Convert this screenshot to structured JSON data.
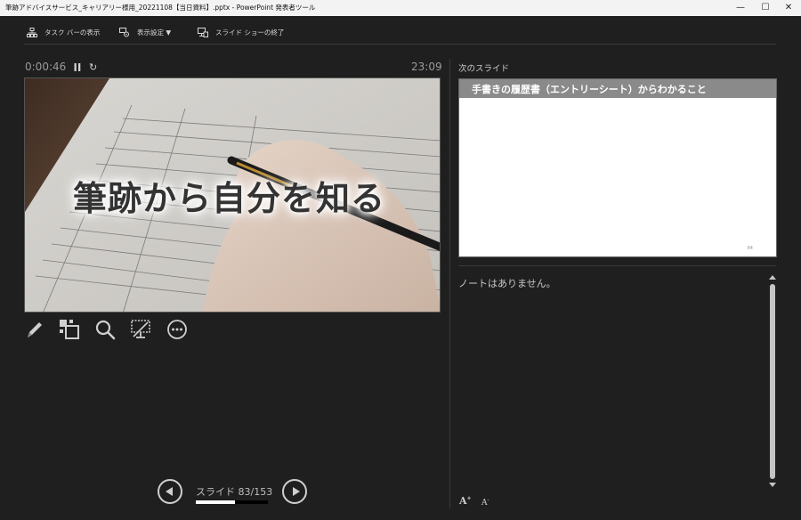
{
  "window": {
    "title": "筆跡アドバイスサービス_キャリアリー様用_20221108【当日資料】.pptx - PowerPoint 発表者ツール",
    "controls": {
      "minimize": "—",
      "maximize": "☐",
      "close": "✕"
    }
  },
  "toolbar": {
    "taskbar_label": "タスク バーの表示",
    "display_settings_label": "表示設定 ▼",
    "end_show_label": "スライド ショーの終了"
  },
  "timer": {
    "elapsed": "0:00:46",
    "pause_icon": "pause-icon",
    "reset_icon": "↻",
    "clock": "23:09"
  },
  "current_slide": {
    "caption": "筆跡から自分を知る"
  },
  "tools": [
    "pen-icon",
    "all-slides-icon",
    "zoom-icon",
    "black-screen-icon",
    "more-options-icon"
  ],
  "next_slide": {
    "label": "次のスライド",
    "title": "手書きの履歴書（エントリーシート）からわかること",
    "page_marker": "84"
  },
  "notes": {
    "text": "ノートはありません。",
    "increase_font": "A",
    "decrease_font": "A"
  },
  "navigation": {
    "counter": "スライド 83/153",
    "progress": 0.542
  },
  "colors": {
    "background": "#1f1f1f",
    "next_header": "#8a8a8a",
    "progress_fill": "#ffffff"
  }
}
